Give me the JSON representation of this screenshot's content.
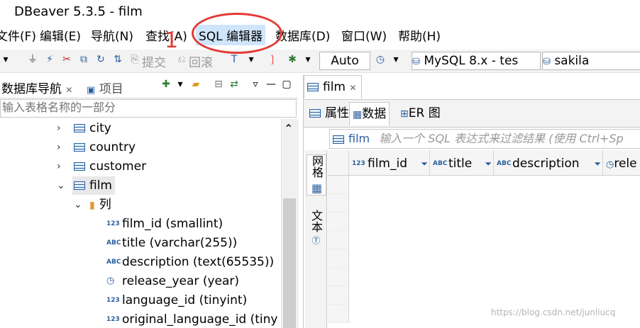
{
  "window": {
    "title": "DBeaver 5.3.5 - film"
  },
  "menu": [
    {
      "label": "文件(F)"
    },
    {
      "label": "编辑(E)"
    },
    {
      "label": "导航(N)"
    },
    {
      "label": "查找(A)"
    },
    {
      "label": "SQL 编辑器"
    },
    {
      "label": "数据库(D)"
    },
    {
      "label": "窗口(W)"
    },
    {
      "label": "帮助(H)"
    }
  ],
  "toolbar": {
    "commit_label": "提交",
    "rollback_label": "回滚",
    "auto_label": "Auto",
    "connection_label": "MySQL 8.x - tes",
    "schema_label": "sakila"
  },
  "left_panel": {
    "tabs": [
      {
        "label": "数据库导航"
      },
      {
        "label": "项目"
      }
    ],
    "filter_placeholder": "输入表格名称的一部分",
    "tree": [
      {
        "label": "city",
        "kind": "table"
      },
      {
        "label": "country",
        "kind": "table"
      },
      {
        "label": "customer",
        "kind": "table"
      },
      {
        "label": "film",
        "kind": "table",
        "expanded": true
      },
      {
        "label": "列",
        "kind": "folder"
      },
      {
        "label": "film_id (smallint)",
        "type": "123"
      },
      {
        "label": "title (varchar(255))",
        "type": "ABC"
      },
      {
        "label": "description (text(65535))",
        "type": "ABC"
      },
      {
        "label": "release_year (year)",
        "type": "clock"
      },
      {
        "label": "language_id (tinyint)",
        "type": "123"
      },
      {
        "label": "original_language_id (tiny",
        "type": "123"
      }
    ]
  },
  "editor": {
    "tab_label": "film",
    "sub_tabs": [
      {
        "label": "属性"
      },
      {
        "label": "数据"
      },
      {
        "label": "ER 图"
      }
    ],
    "filter_table": "film",
    "filter_placeholder": "输入一个 SQL 表达式来过滤结果 (使用 Ctrl+Sp",
    "side_tabs": [
      {
        "label": "网格"
      },
      {
        "label": "文本"
      }
    ],
    "columns": [
      {
        "label": "film_id",
        "type": "123"
      },
      {
        "label": "title",
        "type": "ABC"
      },
      {
        "label": "description",
        "type": "ABC"
      },
      {
        "label": "rele",
        "type": "clock"
      }
    ]
  },
  "annotation": {
    "number": "1"
  },
  "watermark": "https://blog.csdn.net/junliucq",
  "colors": {
    "annotation": "#e53935",
    "accent": "#2a5f9e",
    "highlight": "#cfe5fb"
  }
}
